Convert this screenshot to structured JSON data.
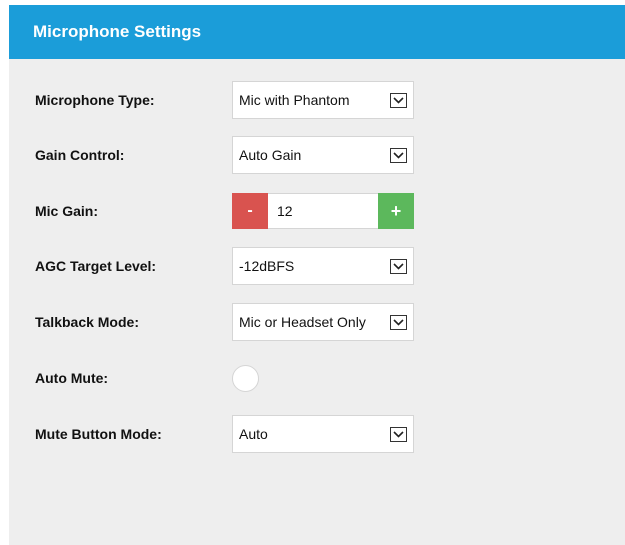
{
  "header": {
    "title": "Microphone Settings"
  },
  "colors": {
    "header_bg": "#1b9dd9",
    "panel_bg": "#eeeeee",
    "minus": "#d9534f",
    "plus": "#5cb85c"
  },
  "fields": {
    "microphone_type": {
      "label": "Microphone Type:",
      "value": "Mic with Phantom"
    },
    "gain_control": {
      "label": "Gain Control:",
      "value": "Auto Gain"
    },
    "mic_gain": {
      "label": "Mic Gain:",
      "value": "12",
      "minus": "-",
      "plus": "+"
    },
    "agc_target_level": {
      "label": "AGC Target Level:",
      "value": "-12dBFS"
    },
    "talkback_mode": {
      "label": "Talkback Mode:",
      "value": "Mic or Headset Only"
    },
    "auto_mute": {
      "label": "Auto Mute:",
      "checked": false
    },
    "mute_button_mode": {
      "label": "Mute Button Mode:",
      "value": "Auto"
    }
  },
  "icons": {
    "dropdown": "chevron-down-icon"
  }
}
